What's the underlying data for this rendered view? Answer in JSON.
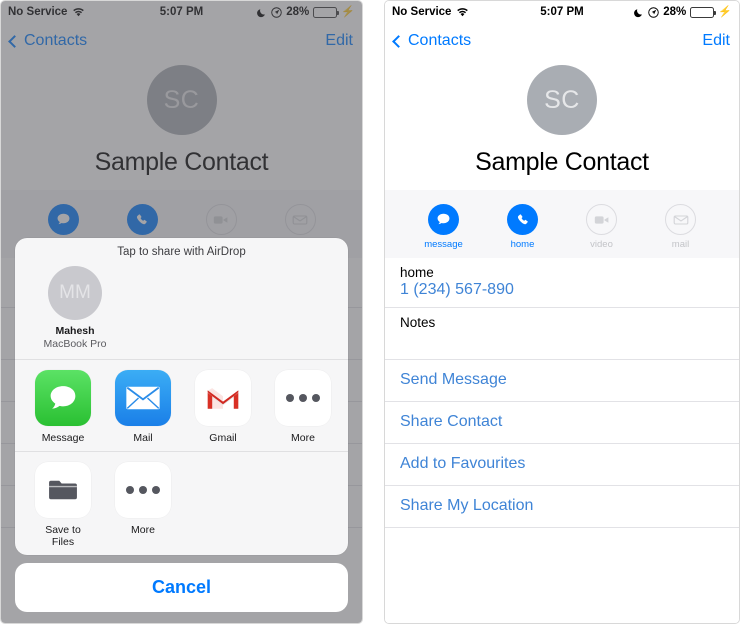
{
  "statusbar": {
    "carrier": "No Service",
    "time": "5:07 PM",
    "battery_percent": "28%",
    "wifi_icon": "wifi-icon",
    "moon_icon": "do-not-disturb-moon-icon",
    "location_icon": "location-services-icon",
    "battery_icon": "battery-icon",
    "charging_icon": "lightning-bolt-icon"
  },
  "navbar": {
    "back_label": "Contacts",
    "edit_label": "Edit"
  },
  "contact": {
    "initials": "SC",
    "name": "Sample Contact"
  },
  "actions": [
    {
      "label": "message",
      "icon": "message-bubble-icon",
      "enabled": true
    },
    {
      "label": "home",
      "icon": "phone-handset-icon",
      "enabled": true
    },
    {
      "label": "video",
      "icon": "video-camera-icon",
      "enabled": false
    },
    {
      "label": "mail",
      "icon": "envelope-icon",
      "enabled": false
    }
  ],
  "info": {
    "phone_label": "home",
    "phone_value": "1 (234) 567-890",
    "notes_label": "Notes"
  },
  "links": [
    {
      "label": "Send Message"
    },
    {
      "label": "Share Contact"
    },
    {
      "label": "Add to Favourites"
    },
    {
      "label": "Share My Location"
    }
  ],
  "share_sheet": {
    "title": "Tap to share with AirDrop",
    "airdrop": {
      "initials": "MM",
      "name": "Mahesh",
      "device": "MacBook Pro"
    },
    "apps": [
      {
        "label": "Message",
        "icon": "messages-app-icon"
      },
      {
        "label": "Mail",
        "icon": "mail-app-icon"
      },
      {
        "label": "Gmail",
        "icon": "gmail-app-icon"
      },
      {
        "label": "More",
        "icon": "more-dots-icon"
      }
    ],
    "activities": [
      {
        "label": "Save to Files",
        "icon": "folder-icon"
      },
      {
        "label": "More",
        "icon": "more-dots-icon"
      }
    ],
    "cancel_label": "Cancel"
  },
  "colors": {
    "accent": "#007aff",
    "link": "#3f84d6",
    "battery_green": "#4cd964",
    "avatar_gray": "#a9adb3"
  }
}
